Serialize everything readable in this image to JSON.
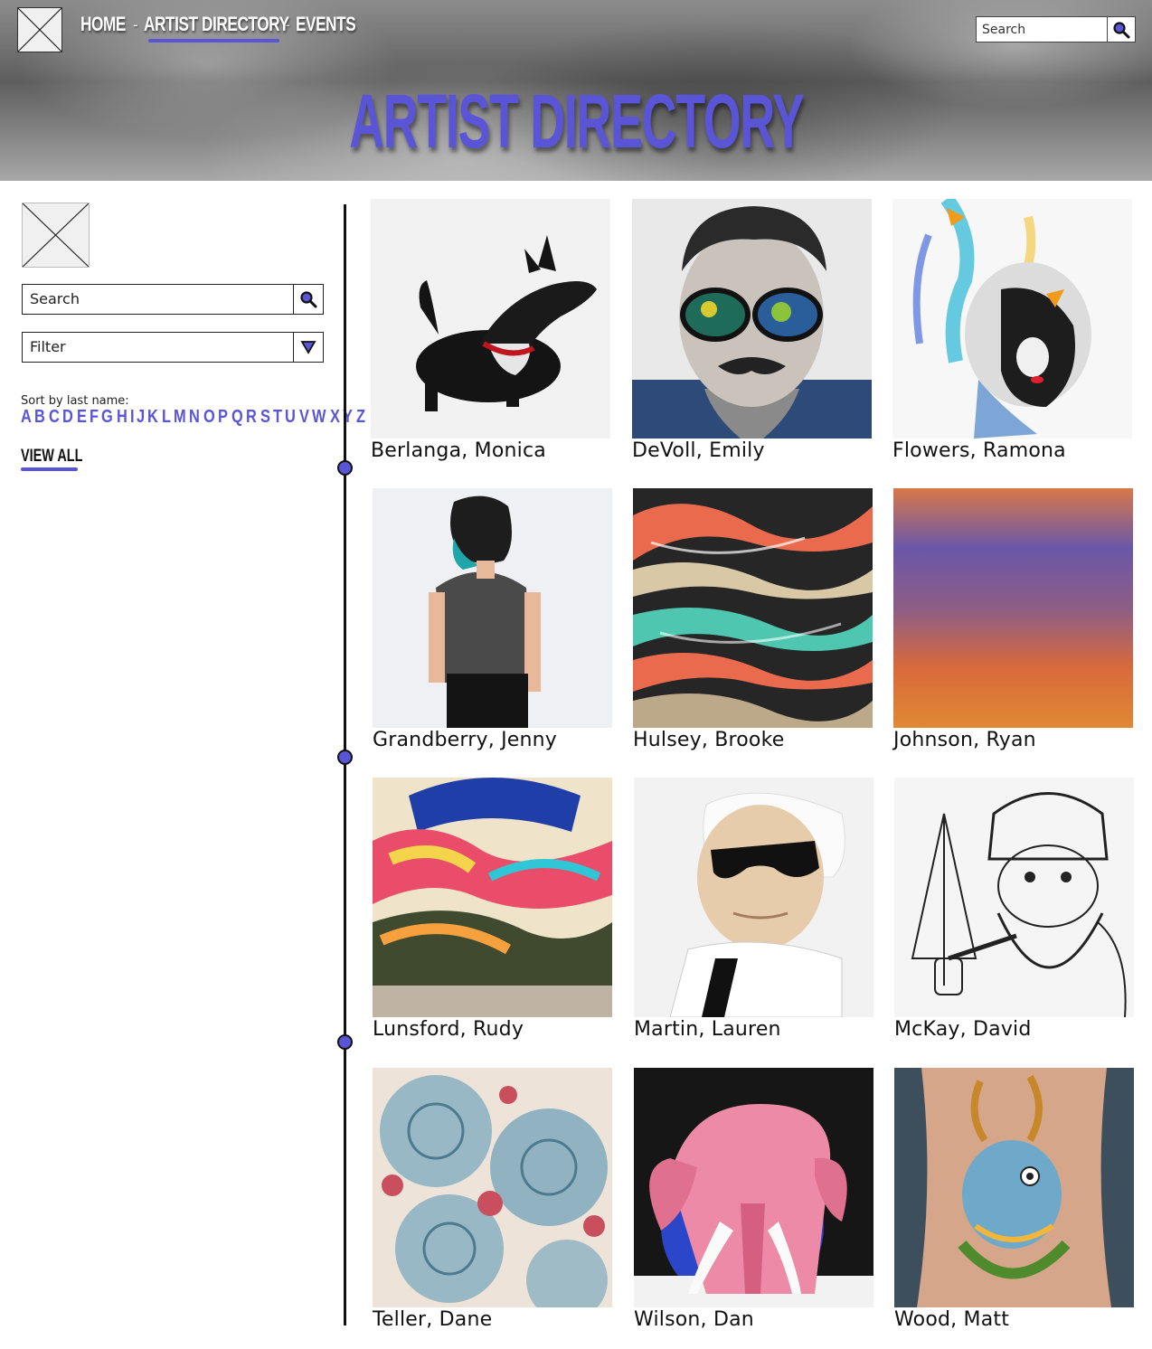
{
  "header": {
    "nav": [
      {
        "label": "HOME"
      },
      {
        "label": "ARTIST DIRECTORY"
      },
      {
        "label": "EVENTS"
      }
    ],
    "separator": "-",
    "search_placeholder": "Search",
    "title": "ARTIST DIRECTORY",
    "accent": "#5a55d6"
  },
  "sidebar": {
    "search_placeholder": "Search",
    "filter_label": "Filter",
    "sort_label": "Sort by last name:",
    "letters": [
      "A",
      "B",
      "C",
      "D",
      "E",
      "F",
      "G",
      "H",
      "I",
      "J",
      "K",
      "L",
      "M",
      "N",
      "O",
      "P",
      "Q",
      "R",
      "S",
      "T",
      "U",
      "V",
      "W",
      "X",
      "Y",
      "Z"
    ],
    "view_all": "VIEW ALL"
  },
  "artists": [
    {
      "name": "Berlanga, Monica"
    },
    {
      "name": "DeVoll, Emily"
    },
    {
      "name": "Flowers, Ramona"
    },
    {
      "name": "Grandberry, Jenny"
    },
    {
      "name": "Hulsey, Brooke"
    },
    {
      "name": "Johnson, Ryan"
    },
    {
      "name": "Lunsford, Rudy"
    },
    {
      "name": "Martin, Lauren"
    },
    {
      "name": "McKay, David"
    },
    {
      "name": "Teller, Dane"
    },
    {
      "name": "Wilson, Dan"
    },
    {
      "name": "Wood, Matt"
    }
  ]
}
